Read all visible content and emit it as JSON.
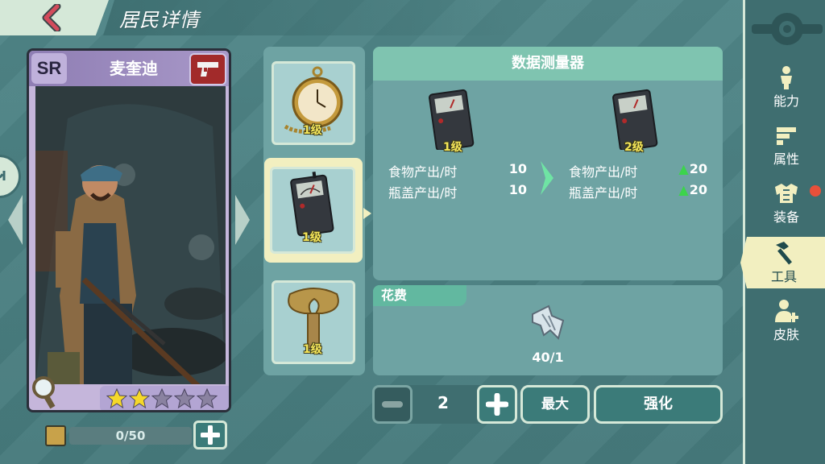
{
  "header": {
    "title": "居民详情",
    "back_icon": "chevron-left-icon"
  },
  "character": {
    "rarity": "SR",
    "name": "麦奎迪",
    "weapon_icon": "pistol-icon",
    "stars_filled": 2,
    "stars_total": 5,
    "xp_text": "0/50"
  },
  "items": [
    {
      "icon": "pocket-watch-icon",
      "level": "1级",
      "selected": false
    },
    {
      "icon": "data-meter-icon",
      "level": "1级",
      "selected": true
    },
    {
      "icon": "wind-up-key-icon",
      "level": "1级",
      "selected": false
    }
  ],
  "detail": {
    "title": "数据测量器",
    "current": {
      "level": "1级",
      "stats": [
        {
          "label": "食物产出/时",
          "value": "10"
        },
        {
          "label": "瓶盖产出/时",
          "value": "10"
        }
      ]
    },
    "next": {
      "level": "2级",
      "stats": [
        {
          "label": "食物产出/时",
          "value": "20"
        },
        {
          "label": "瓶盖产出/时",
          "value": "20"
        }
      ]
    }
  },
  "cost": {
    "label": "花费",
    "material_icon": "metal-scrap-icon",
    "count": "40/1"
  },
  "controls": {
    "quantity": "2",
    "max_label": "最大",
    "upgrade_label": "强化"
  },
  "sidebar": {
    "items": [
      {
        "label": "能力",
        "icon": "person-icon",
        "active": false
      },
      {
        "label": "属性",
        "icon": "bars-icon",
        "active": false
      },
      {
        "label": "装备",
        "icon": "armor-icon",
        "active": false,
        "notification": true
      },
      {
        "label": "工具",
        "icon": "hammer-icon",
        "active": true
      },
      {
        "label": "皮肤",
        "icon": "person-add-icon",
        "active": false
      }
    ]
  },
  "colors": {
    "background": "#4a7f81",
    "panel": "#6ea3a3",
    "accent_cream": "#f2efc0",
    "level_yellow": "#f5e65a",
    "up_green": "#3cd44c",
    "notification_red": "#e8503a"
  }
}
